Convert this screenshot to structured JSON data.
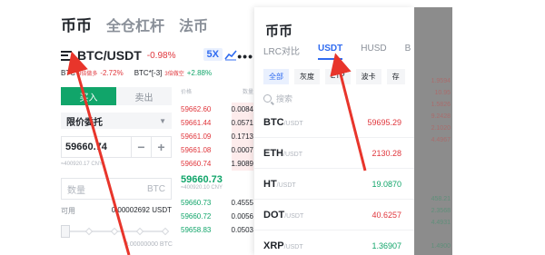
{
  "top_tabs": [
    "币币",
    "全仓杠杆",
    "法币"
  ],
  "pair": {
    "name": "BTC/USDT",
    "change": "-0.98%",
    "leverage": "5X"
  },
  "sub_tickers": [
    {
      "name": "BTC",
      "tag": "3倍做多",
      "change": "-2.72%",
      "dir": "red"
    },
    {
      "name": "BTC*[-3]",
      "tag": "3倍做空",
      "change": "+2.88%",
      "dir": "green"
    }
  ],
  "order": {
    "buy_label": "买入",
    "sell_label": "卖出",
    "order_type": "限价委托",
    "price": "59660.74",
    "approx": "≈400920.17 CNY",
    "qty_placeholder": "数量",
    "qty_unit": "BTC",
    "avail_label": "可用",
    "avail_value": "0.00002692 USDT",
    "trade_amount": "0.00000000 BTC"
  },
  "book": {
    "price_head": "价格",
    "qty_head": "数量",
    "asks": [
      {
        "p": "59662.60",
        "q": "0.0084"
      },
      {
        "p": "59661.44",
        "q": "0.0571"
      },
      {
        "p": "59661.09",
        "q": "0.1713"
      },
      {
        "p": "59661.08",
        "q": "0.0007"
      },
      {
        "p": "59660.74",
        "q": "1.9089"
      }
    ],
    "mid": "59660.73",
    "mid_sub": "≈400920.10 CNY",
    "bids": [
      {
        "p": "59660.73",
        "q": "0.4555"
      },
      {
        "p": "59660.72",
        "q": "0.0056"
      },
      {
        "p": "59658.83",
        "q": "0.0503"
      }
    ]
  },
  "popup": {
    "title": "币币",
    "tabs": [
      "LRC对比",
      "USDT",
      "HUSD",
      "B"
    ],
    "active_tab": 1,
    "filters": [
      "全部",
      "灰度",
      "ETP",
      "波卡",
      "存"
    ],
    "active_filter": 0,
    "search_placeholder": "搜索",
    "coins": [
      {
        "name": "BTC",
        "quote": "/USDT",
        "price": "59695.29",
        "dir": "red"
      },
      {
        "name": "ETH",
        "quote": "/USDT",
        "price": "2130.28",
        "dir": "red"
      },
      {
        "name": "HT",
        "quote": "/USDT",
        "price": "19.0870",
        "dir": "green"
      },
      {
        "name": "DOT",
        "quote": "/USDT",
        "price": "40.6257",
        "dir": "red"
      },
      {
        "name": "XRP",
        "quote": "/USDT",
        "price": "1.36907",
        "dir": "green"
      }
    ]
  },
  "dimmed": [
    {
      "t": "",
      "c": ""
    },
    {
      "t": "",
      "c": ""
    },
    {
      "t": "",
      "c": ""
    },
    {
      "t": "",
      "c": ""
    },
    {
      "t": "",
      "c": ""
    },
    {
      "t": "",
      "c": ""
    },
    {
      "t": "1.9594",
      "c": "r"
    },
    {
      "t": "10.95",
      "c": "r"
    },
    {
      "t": "1.5826",
      "c": "r"
    },
    {
      "t": "9.2428",
      "c": "r"
    },
    {
      "t": "2.1020",
      "c": "r"
    },
    {
      "t": "4.4967",
      "c": "r"
    },
    {
      "t": "",
      "c": ""
    },
    {
      "t": "",
      "c": ""
    },
    {
      "t": "",
      "c": ""
    },
    {
      "t": "",
      "c": ""
    },
    {
      "t": "458.21",
      "c": "g"
    },
    {
      "t": "2.3568",
      "c": "g"
    },
    {
      "t": "4.4931",
      "c": "g"
    },
    {
      "t": "",
      "c": ""
    },
    {
      "t": "1.4900",
      "c": "g"
    },
    {
      "t": "2.0021",
      "c": "g"
    }
  ],
  "colors": {
    "red": "#e0363c",
    "green": "#11a56a",
    "blue": "#2f6bf0",
    "arrow": "#e8352b"
  }
}
